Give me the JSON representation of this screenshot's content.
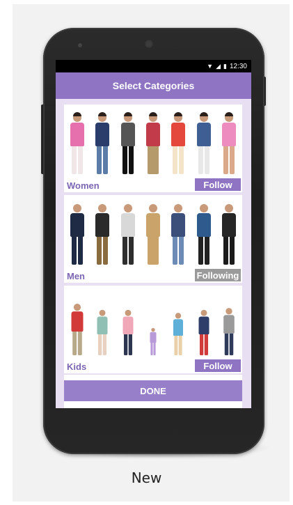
{
  "statusbar": {
    "time": "12:30",
    "signal_icon": "signal-icon",
    "wifi_icon": "wifi-icon",
    "battery_icon": "battery-icon"
  },
  "appbar": {
    "title": "Select Categories"
  },
  "categories": [
    {
      "label": "Women",
      "action": "Follow",
      "state": "follow"
    },
    {
      "label": "Men",
      "action": "Following",
      "state": "following"
    },
    {
      "label": "Kids",
      "action": "Follow",
      "state": "follow"
    }
  ],
  "footer": {
    "done_label": "DONE"
  },
  "caption": "New",
  "colors": {
    "accent": "#8f74c4",
    "screen_bg": "#e8dff3",
    "following": "#9a9a9a"
  }
}
